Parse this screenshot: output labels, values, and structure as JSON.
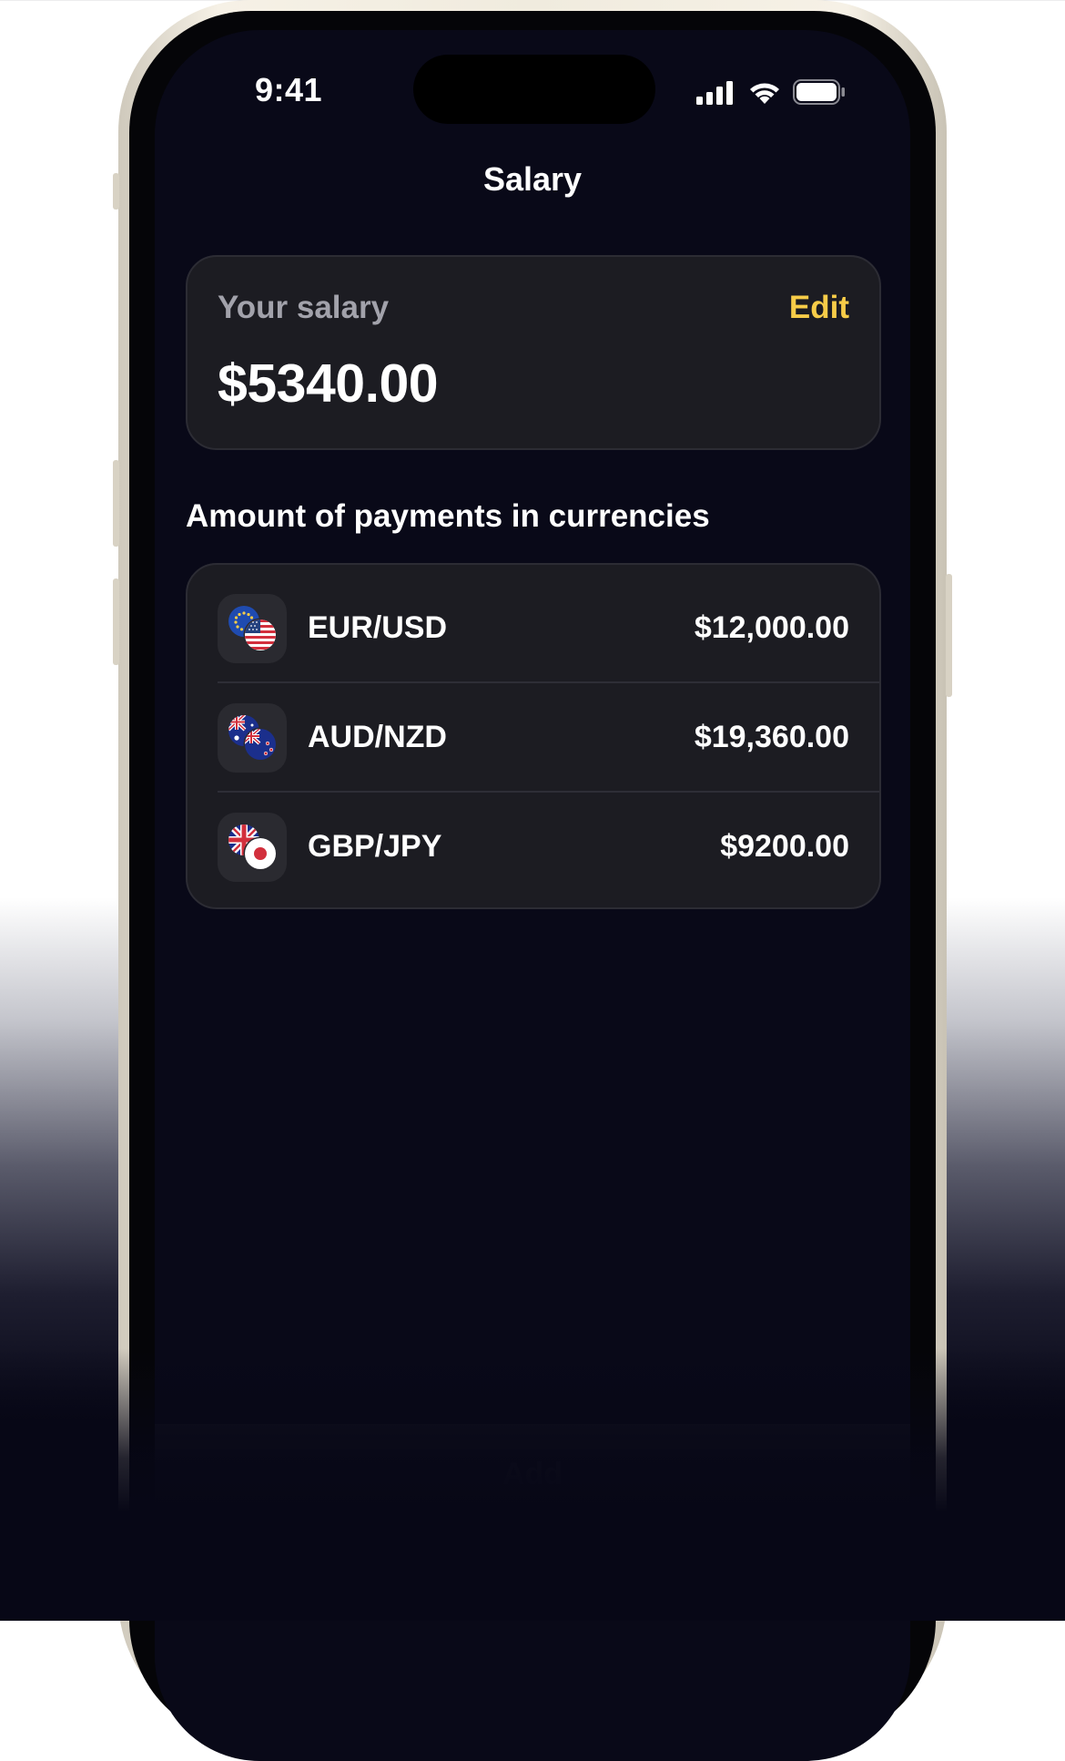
{
  "status_bar": {
    "time": "9:41"
  },
  "nav": {
    "title": "Salary"
  },
  "salary_card": {
    "label": "Your salary",
    "edit_label": "Edit",
    "amount": "$5340.00"
  },
  "section_title": "Amount of payments in currencies",
  "currencies": [
    {
      "pair": "EUR/USD",
      "amount": "$12,000.00",
      "icon": "eur-usd-flags-icon"
    },
    {
      "pair": "AUD/NZD",
      "amount": "$19,360.00",
      "icon": "aud-nzd-flags-icon"
    },
    {
      "pair": "GBP/JPY",
      "amount": "$9200.00",
      "icon": "gbp-jpy-flags-icon"
    }
  ],
  "add_button": {
    "label": "Add"
  },
  "colors": {
    "accent": "#f7cc48",
    "background": "#090918",
    "card": "#1c1c22",
    "frame": "#f0ebde"
  }
}
